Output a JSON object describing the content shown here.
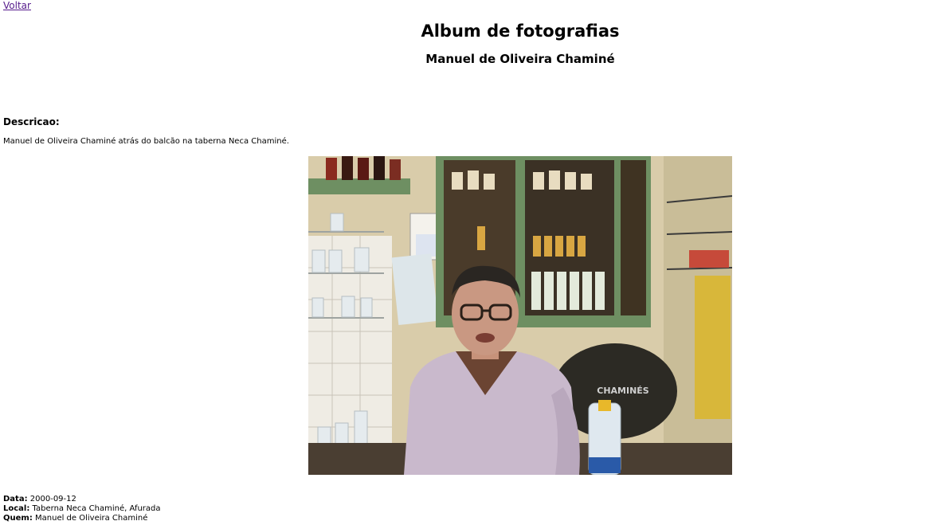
{
  "nav": {
    "back_label": "Voltar"
  },
  "header": {
    "title": "Album de fotografias",
    "subtitle": "Manuel de Oliveira Chaminé"
  },
  "description": {
    "heading": "Descricao:",
    "text": "Manuel de Oliveira Chaminé atrás do balcão na taberna Neca Chaminé."
  },
  "photo": {
    "bottle_label": "",
    "barrel_label": "CHAMINÉS"
  },
  "details": {
    "date_label": "Data:",
    "date_value": "2000-09-12",
    "place_label": "Local:",
    "place_value": "Taberna Neca Chaminé, Afurada",
    "who_label": "Quem:",
    "who_value": "Manuel de Oliveira Chaminé"
  },
  "colors": {
    "link": "#551a8b",
    "shelf_green": "#6e8f62",
    "sweater": "#c9b9cc"
  }
}
